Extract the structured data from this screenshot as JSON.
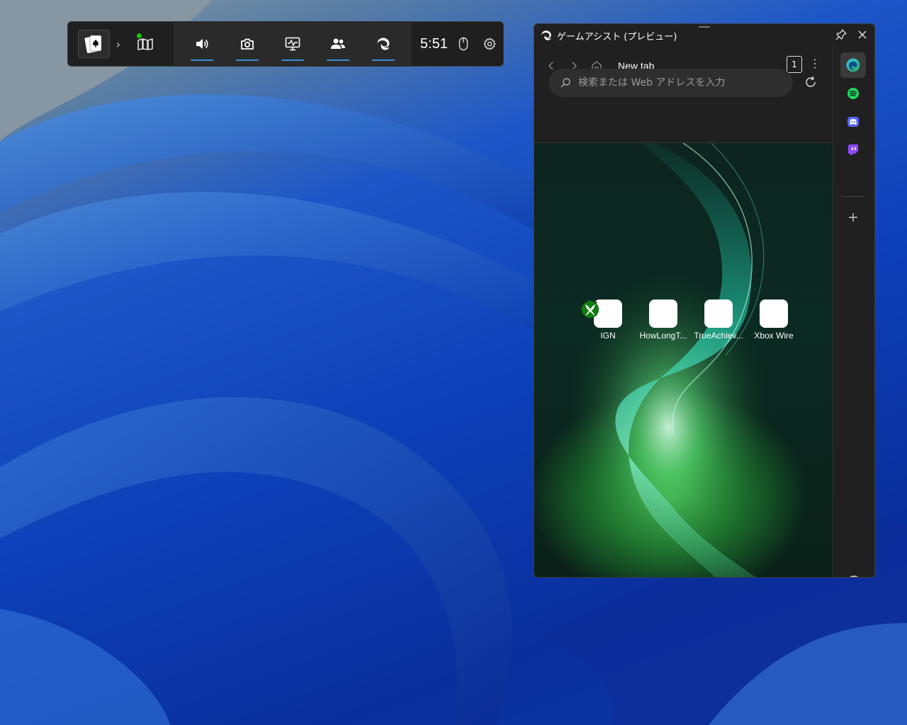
{
  "gamebar": {
    "clock": "5:51",
    "active_app_icon": "solitaire-card-icon",
    "tools": [
      {
        "name": "audio",
        "icon": "speaker-icon"
      },
      {
        "name": "capture",
        "icon": "camera-icon"
      },
      {
        "name": "performance",
        "icon": "monitor-pulse-icon"
      },
      {
        "name": "social",
        "icon": "people-icon"
      },
      {
        "name": "edge",
        "icon": "edge-icon"
      }
    ],
    "accent_color": "#3b8ede"
  },
  "assist": {
    "title": "ゲームアシスト (プレビュー)",
    "tab_title": "New tab",
    "tab_count": "1",
    "search_placeholder": "検索または Web アドレスを入力",
    "quick_links": [
      {
        "label": "IGN",
        "icon": "ign-icon"
      },
      {
        "label": "HowLongT...",
        "icon": "howlongtobeat-icon"
      },
      {
        "label": "TrueAchiev...",
        "icon": "trueachievements-icon"
      },
      {
        "label": "Xbox Wire",
        "icon": "xbox-icon"
      }
    ],
    "sidebar": [
      {
        "name": "edge",
        "icon": "edge-icon"
      },
      {
        "name": "spotify",
        "icon": "spotify-icon"
      },
      {
        "name": "discord",
        "icon": "discord-icon"
      },
      {
        "name": "twitch",
        "icon": "twitch-icon"
      }
    ]
  }
}
